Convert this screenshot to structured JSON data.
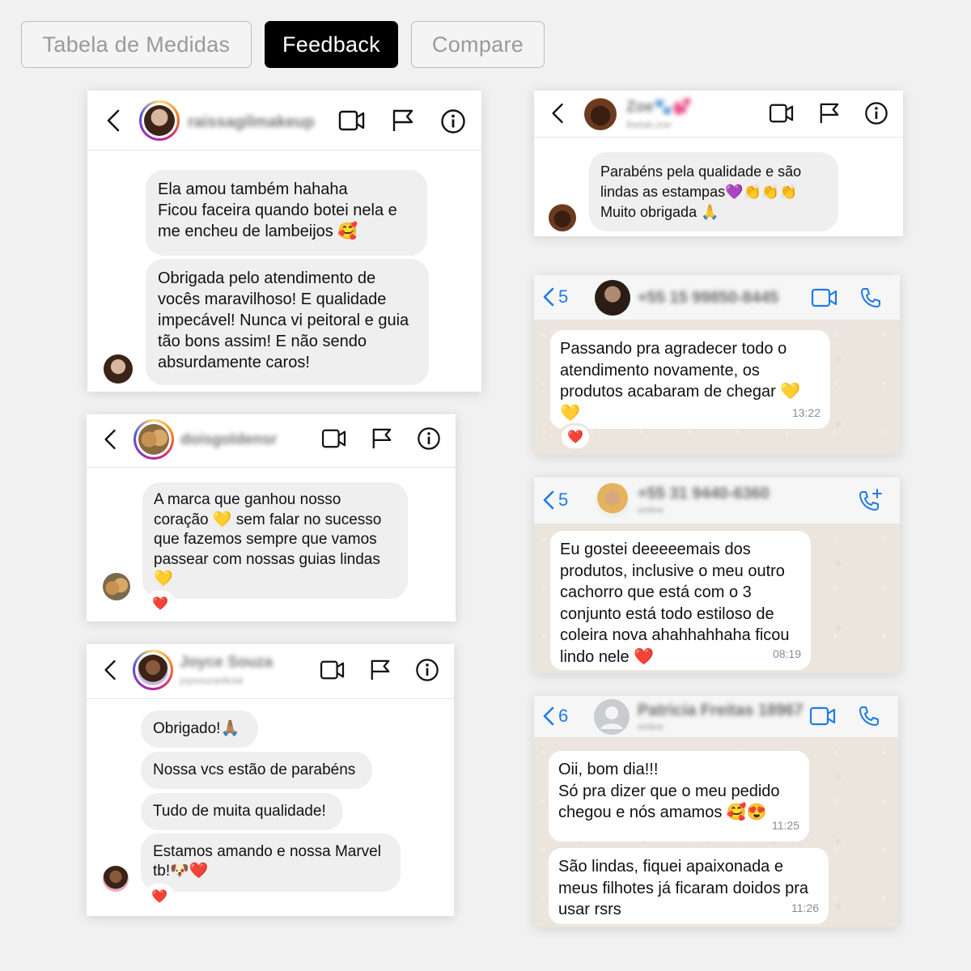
{
  "tabs": [
    {
      "label": "Tabela de Medidas",
      "active": false
    },
    {
      "label": "Feedback",
      "active": true
    },
    {
      "label": "Compare",
      "active": false
    }
  ],
  "cards": {
    "ig1": {
      "username": "raissagilmakeup",
      "messages": [
        "Ela amou também hahaha\nFicou faceira quando botei nela e me encheu de lambeijos 🥰",
        "Obrigada pelo atendimento de vocês maravilhoso! E qualidade impecável! Nunca vi peitoral e guia tão bons assim! E não sendo absurdamente caros!"
      ]
    },
    "ig2": {
      "username": "doisgoldensr",
      "messages": [
        "A marca que ganhou nosso coração 💛 sem falar no sucesso que fazemos sempre que vamos passear com nossas guias lindas 💛"
      ],
      "reaction": "❤️"
    },
    "ig3": {
      "username": "Joyce Souza",
      "subtitle": "joysouzaoficial",
      "messages": [
        "Obrigado!🙏🏽",
        "Nossa vcs estão de parabéns",
        "Tudo de muita qualidade!",
        "Estamos amando e nossa Marvel tb!🐶❤️"
      ],
      "reaction": "❤️"
    },
    "ig4": {
      "username": "Zoe🐾💕",
      "subtitle": "thelab.zoe",
      "messages": [
        "Parabéns pela qualidade e são lindas as estampas💜👏👏👏\nMuito obrigada 🙏"
      ]
    },
    "wa1": {
      "back_count": "5",
      "contact": "+55 15 99850-8445",
      "messages": [
        {
          "text": "Passando pra agradecer todo o atendimento novamente, os produtos acabaram de chegar 💛💛",
          "time": "13:22"
        }
      ],
      "reaction": "❤️"
    },
    "wa2": {
      "back_count": "5",
      "contact": "+55 31 9440-6360",
      "status": "online",
      "messages": [
        {
          "text": "Eu gostei deeeeemais dos produtos, inclusive o meu outro cachorro que está com o 3 conjunto está todo estiloso de coleira nova ahahhahhaha ficou lindo nele ❤️",
          "time": "08:19"
        }
      ]
    },
    "wa3": {
      "back_count": "6",
      "contact": "Patricia Freitas 18967",
      "status": "online",
      "messages": [
        {
          "text": "Oii, bom dia!!!\nSó pra dizer que o meu pedido chegou e nós amamos 🥰😍",
          "time": "11:25"
        },
        {
          "text": "São lindas, fiquei apaixonada e meus filhotes já ficaram doidos pra usar rsrs",
          "time": "11:26"
        }
      ]
    }
  },
  "icons": {
    "back": "chevron-left-icon",
    "video": "video-camera-icon",
    "flag": "flag-icon",
    "info": "info-icon",
    "phone": "phone-icon",
    "add_call": "add-call-icon"
  },
  "colors": {
    "accent_whatsapp": "#1f7ae6",
    "bubble_instagram": "#efefef",
    "chat_background": "#ece5dd",
    "active_tab": "#000000"
  }
}
